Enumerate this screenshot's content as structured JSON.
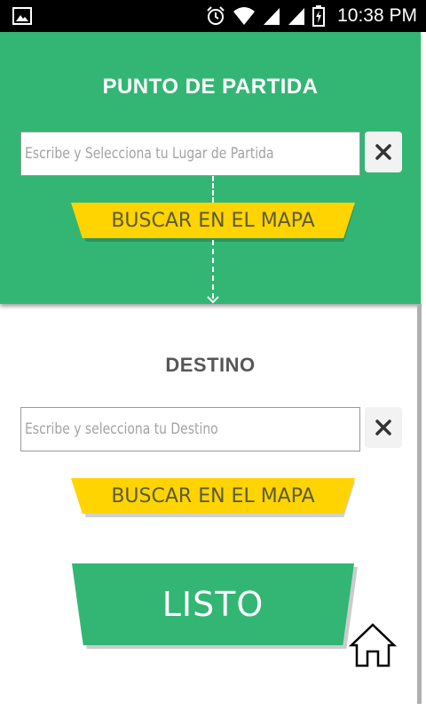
{
  "status_bar": {
    "time": "10:38 PM",
    "icons": [
      "image-icon",
      "alarm-icon",
      "wifi-icon",
      "signal-icon",
      "signal-icon",
      "battery-icon"
    ]
  },
  "origin": {
    "title": "PUNTO DE PARTIDA",
    "placeholder": "Escribe y Selecciona tu Lugar de Partida",
    "value": "",
    "clear_label": "×",
    "map_button": "BUSCAR EN EL MAPA"
  },
  "destination": {
    "title": "DESTINO",
    "placeholder": "Escribe y selecciona tu Destino",
    "value": "",
    "clear_label": "×",
    "map_button": "BUSCAR EN EL MAPA"
  },
  "submit": {
    "label": "LISTO"
  },
  "colors": {
    "green": "#33b674",
    "yellow": "#ffd400",
    "title_gray": "#575757"
  }
}
